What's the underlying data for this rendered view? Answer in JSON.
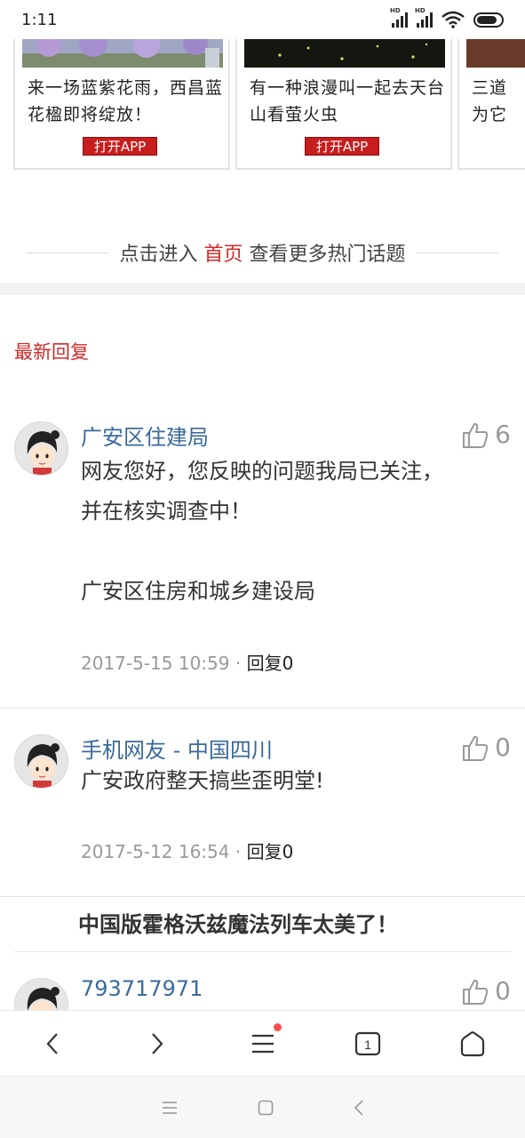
{
  "status_bar": {
    "time": "1:11",
    "hd1": "HD",
    "hd2": "HD"
  },
  "cards": [
    {
      "title": "来一场蓝紫花雨，西昌蓝花楹即将绽放！",
      "button": "打开APP"
    },
    {
      "title": "有一种浪漫叫一起去天台山看萤火虫",
      "button": "打开APP"
    },
    {
      "title": "三道为它"
    }
  ],
  "home_link": {
    "prefix": "点击进入",
    "link": "首页",
    "suffix": "查看更多热门话题"
  },
  "section_title": "最新回复",
  "comments": [
    {
      "author": "广安区住建局",
      "likes": "6",
      "body_line1": "网友您好，您反映的问题我局已关注，",
      "body_line2": "并在核实调查中！",
      "body_line3": "广安区住房和城乡建设局",
      "time": "2017-5-15 10:59",
      "sep": "·",
      "reply": "回复0"
    },
    {
      "author": "手机网友 - 中国四川",
      "likes": "0",
      "body_line1": "广安政府整天搞些歪明堂!",
      "time": "2017-5-12 16:54",
      "sep": "·",
      "reply": "回复0"
    },
    {
      "author": "793717971",
      "likes": "0"
    }
  ],
  "promo_title": "中国版霍格沃兹魔法列车太美了！",
  "colors": {
    "accent_red": "#d02a2a",
    "author_blue": "#3a6a9a",
    "button_red": "#c81d1d"
  },
  "icons": [
    "signal-icon",
    "wifi-icon",
    "battery-icon",
    "thumbs-up-icon",
    "back-icon",
    "forward-icon",
    "menu-icon",
    "tabs-icon",
    "home-icon",
    "recents-icon",
    "square-home-icon",
    "system-back-icon"
  ]
}
